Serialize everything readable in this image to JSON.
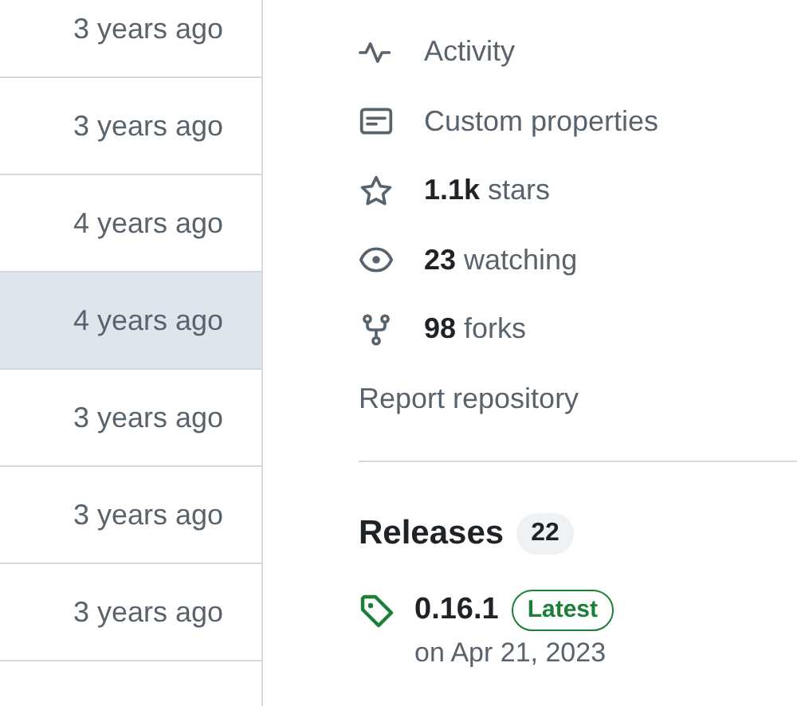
{
  "file_rows": [
    {
      "age": "3 years ago",
      "highlighted": false
    },
    {
      "age": "3 years ago",
      "highlighted": false
    },
    {
      "age": "4 years ago",
      "highlighted": false
    },
    {
      "age": "4 years ago",
      "highlighted": true
    },
    {
      "age": "3 years ago",
      "highlighted": false
    },
    {
      "age": "3 years ago",
      "highlighted": false
    },
    {
      "age": "3 years ago",
      "highlighted": false
    }
  ],
  "about_links": [
    {
      "kind": "activity",
      "text": "Activity"
    },
    {
      "kind": "properties",
      "text": "Custom properties"
    },
    {
      "kind": "star",
      "text": "**1.1k** stars"
    },
    {
      "kind": "eye",
      "text": "**23** watching"
    },
    {
      "kind": "fork",
      "text": "**98** forks"
    },
    {
      "kind": "none",
      "text": "Report repository"
    }
  ],
  "releases": {
    "title": "Releases",
    "count": "22",
    "latest": {
      "version": "0.16.1",
      "badge": "Latest",
      "date": "on Apr 21, 2023"
    }
  }
}
